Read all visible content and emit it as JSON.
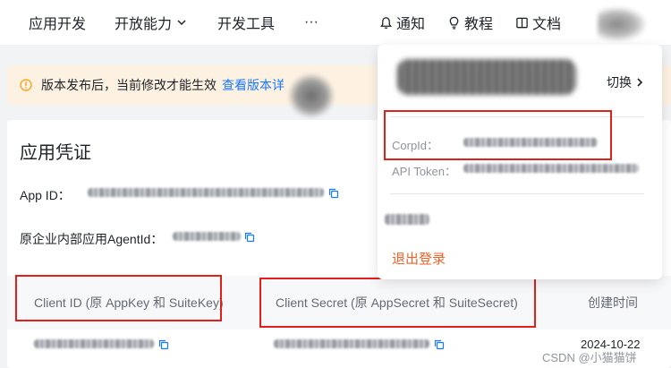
{
  "nav": {
    "items": [
      {
        "label": "应用开发"
      },
      {
        "label": "开放能力"
      },
      {
        "label": "开发工具"
      },
      {
        "label": "···"
      }
    ],
    "notify_label": "通知",
    "tutorial_label": "教程",
    "docs_label": "文档"
  },
  "notice": {
    "text": "版本发布后，当前修改才能生效",
    "link": "查看版本详"
  },
  "credentials": {
    "title": "应用凭证",
    "app_id_label": "App ID：",
    "agent_id_label": "原企业内部应用AgentId：",
    "columns": [
      "Client ID (原 AppKey 和 SuiteKey)",
      "Client Secret (原 AppSecret 和 SuiteSecret)",
      "创建时间"
    ],
    "row_date": "2024-10-22"
  },
  "account_menu": {
    "switch_label": "切换",
    "corpid_label": "CorpId：",
    "api_token_label": "API Token：",
    "logout_label": "退出登录"
  },
  "watermark": "CSDN @小猫猫饼",
  "colors": {
    "accent_blue": "#1677ff",
    "highlight_red": "#e0201b",
    "logout_orange": "#f0622a",
    "notice_bg": "#fdf2e2"
  }
}
